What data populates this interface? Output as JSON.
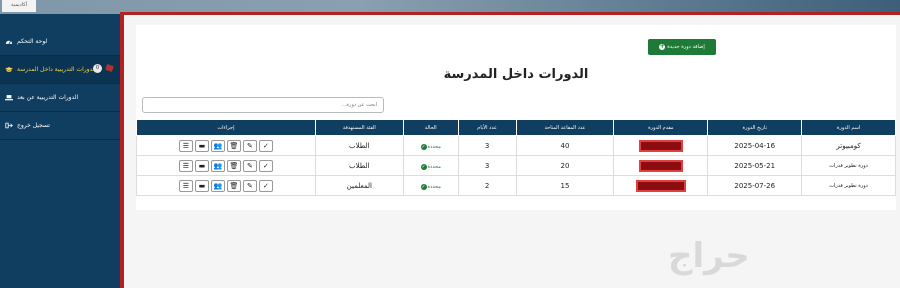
{
  "app": {
    "logo_text": "أكاديمية"
  },
  "sidebar": {
    "items": [
      {
        "label": "لوحة التحكم",
        "icon": "dashboard-icon"
      },
      {
        "label": "الدورات التدريبية داخل المدرسة",
        "icon": "graduation-cap-icon",
        "badge": "0",
        "active": true
      },
      {
        "label": "الدورات التدريبية عن بعد",
        "icon": "laptop-icon"
      },
      {
        "label": "تسجيل خروج",
        "icon": "logout-icon"
      }
    ]
  },
  "main": {
    "add_button_label": "إضافة دورة جديدة",
    "title": "الدورات داخل المدرسة",
    "search": {
      "placeholder": "ابحث عن دورة...",
      "value": ""
    },
    "table": {
      "headers": [
        "اسم الدورة",
        "تاريخ الدورة",
        "مقدم الدورة",
        "عدد المقاعد المتاحة",
        "عدد الأيام",
        "الحالة",
        "الفئة المستهدفة",
        "إجراءات"
      ],
      "rows": [
        {
          "name": "كومبيوتر",
          "date": "2025-04-16",
          "seats": "40",
          "days": "3",
          "status": "محددة",
          "audience": "الطلاب"
        },
        {
          "name": "دورة تطوير قدرات",
          "date": "2025-05-21",
          "seats": "20",
          "days": "3",
          "status": "محددة",
          "audience": "الطلاب"
        },
        {
          "name": "دورة تطوير قدرات",
          "date": "2025-07-26",
          "seats": "15",
          "days": "2",
          "status": "محددة",
          "audience": "المعلمين"
        }
      ]
    }
  },
  "watermark": "حراج",
  "colors": {
    "sidebar": "#0f3e61",
    "accent_red": "#b22222",
    "add_button": "#1e7a37",
    "active_text": "#f6d24a"
  }
}
